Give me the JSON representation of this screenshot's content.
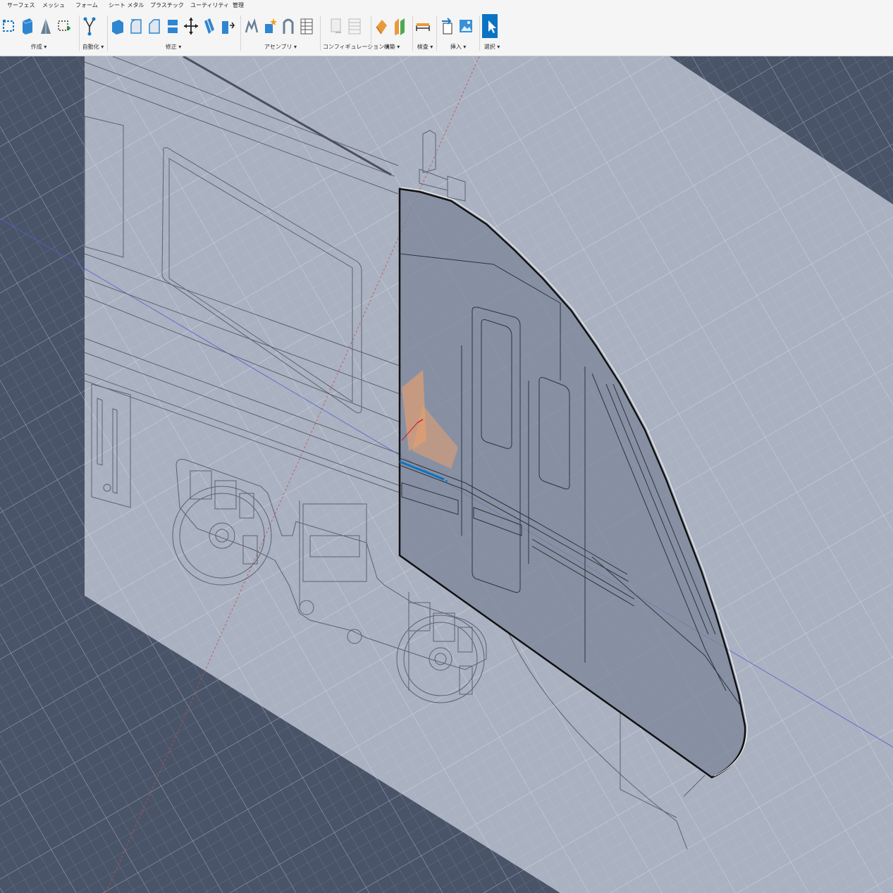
{
  "ribbon": {
    "tabs": [
      "サーフェス",
      "メッシュ",
      "フォーム",
      "シート メタル",
      "プラスチック",
      "ユーティリティ",
      "管理"
    ],
    "groups": {
      "create": "作成 ▾",
      "automate": "自動化 ▾",
      "modify": "修正 ▾",
      "assemble": "アセンブリ ▾",
      "configure": "コンフィギュレーション ▾",
      "construct": "構築 ▾",
      "inspect": "検査 ▾",
      "insert": "挿入 ▾",
      "select": "選択 ▾"
    }
  },
  "browser": {
    "dropdown_icon": "gear-icon"
  },
  "colors": {
    "viewport_bg": "#4a5468",
    "canvas": "#a9b1c2",
    "selection_blue": "#0a74c4",
    "origin_orange": "#e8a070"
  }
}
